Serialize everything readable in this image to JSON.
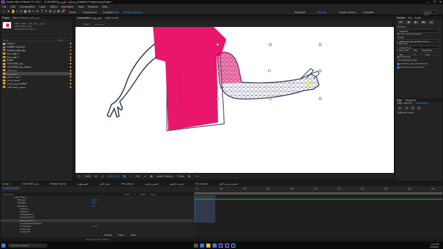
{
  "window": {
    "title": "Adobe After Effects CC 2017 - D:\\WORKS\\بروجيكت كورس\\Untitled Project copy2.aep *",
    "controls": [
      "—",
      "❐",
      "✕"
    ]
  },
  "menu": [
    "File",
    "Edit",
    "Composition",
    "Layer",
    "Effect",
    "Animation",
    "View",
    "Window",
    "Help"
  ],
  "toolbar": {
    "options": [
      "Mode",
      "Expansion",
      "3",
      "Triangles",
      "350",
      "Record Options"
    ],
    "workspaces": [
      "Standard",
      "Default",
      "Small Screen",
      "Libraries"
    ],
    "search_placeholder": "Search Help"
  },
  "project": {
    "tabs": [
      "Project",
      "Effect Controls جسم كامل"
    ],
    "meta_name": "قميص وجسم كامل - 1920 × 1080",
    "meta_line2": "1920 x 1080 (1.00)",
    "meta_line3": "Δ 0;00;20;00, 30.00 fps",
    "columns": [
      "Name",
      "Type"
    ],
    "items": [
      {
        "name": "Comp 1",
        "color": "#d9a23a"
      },
      {
        "name": "GAMED 400.mp4",
        "color": "#7a7a7a"
      },
      {
        "name": "Granted_logo.png",
        "color": "#7a7a7a"
      },
      {
        "name": "Pre-comp 1",
        "color": "#d9a23a"
      },
      {
        "name": "Pre-comp 2",
        "color": "#d9a23a"
      },
      {
        "name": "Solids",
        "color": "#d9a23a"
      },
      {
        "name": "YOUTUBE شعار",
        "color": "#d9a23a"
      },
      {
        "name": "YOUTUBE شعار Lalune",
        "color": "#d9a23a"
      },
      {
        "name": "جسم كامل",
        "color": "#d9a23a"
      },
      {
        "name": "جسم مع يد",
        "color": "#d9a23a",
        "selected": true
      },
      {
        "name": "جسم يد قميص",
        "color": "#d9a23a"
      },
      {
        "name": "قميص وجسم",
        "color": "#d9a23a"
      },
      {
        "name": "قميص وجسم Lalune",
        "color": "#d9a23a"
      },
      {
        "name": "قميص وجسم كامل",
        "color": "#d9a23a"
      }
    ],
    "bottom": [
      "8 bpc"
    ]
  },
  "viewer": {
    "tabs": [
      "Composition جسم مع يد",
      "Layer (none)"
    ],
    "subtabs": [
      "Comp 1",
      "جسم مع يد",
      "جسم كامل"
    ],
    "footer": {
      "zoom": "100%",
      "timecode": "0;00;00;00",
      "resolution": "Full",
      "camera": "Active Camera",
      "views": "1 View",
      "offset": "+0.0"
    }
  },
  "right": {
    "tabs": [
      "Preview",
      "Info",
      "Audio"
    ],
    "shortcut_label": "Shortcut",
    "shortcut_value": "Spacebar",
    "cache_label": "Cache Before Playback",
    "range_label": "Range",
    "range_value": "Work Area Extended By Current...",
    "play_from_label": "Play From",
    "play_from_value": "Current Time",
    "frame_rate_label": "Frame Rate",
    "skip_label": "Skip",
    "resolution_label": "Resolution",
    "frame_rate_value": "(30)",
    "skip_value": "0",
    "resolution_value": "Auto",
    "full_screen_label": "Full Screen",
    "stop_label": "On (Spacebar) Stop:",
    "opt1": "If caching, play cached frames",
    "opt2": "Move time to preview time",
    "align_tabs": [
      "Align",
      "Paragraph"
    ],
    "align_label": "Align Layers to:",
    "align_value": "Composition",
    "distribute_label": "Distribute Layers:"
  },
  "timeline": {
    "tabs": [
      "Comp 1",
      "YOUTUBE شعار",
      "Render Queue",
      "جسم مع يد",
      "جسم كامل",
      "Pre-comp 1",
      "قميص وجسم",
      "جسم يد قميص",
      "Pre-comp 2",
      "قميص وجسم كامل"
    ],
    "current_time": "0;00;00;00",
    "columns": [
      "Layer Name",
      "Mode",
      "T",
      "TrkMat",
      "Parent"
    ],
    "layers": [
      {
        "name": "Layer Name",
        "value": ""
      },
      {
        "name": "▾ Puppet",
        "value": "Reset"
      },
      {
        "name": "Triangles",
        "value": "350"
      },
      {
        "name": "Expansion",
        "value": "3.0"
      },
      {
        "name": "▾ Mesh 1",
        "value": ""
      },
      {
        "name": "▾ Deform",
        "value": ""
      },
      {
        "name": "▸ Puppet Pin 3",
        "value": ""
      },
      {
        "name": "▸ Puppet Pin 2",
        "value": ""
      },
      {
        "name": "▸ Puppet Pin 1",
        "value": "",
        "selected": true
      },
      {
        "name": "▸ Compositing Options",
        "value": ""
      },
      {
        "name": "▸ Transform",
        "value": "Reset"
      },
      {
        "name": "26  جسم مع",
        "value": ""
      },
      {
        "name": "▸ Layer 28",
        "value": ""
      }
    ],
    "layer_row_controls": [
      "Normal",
      "None",
      "None"
    ],
    "ruler": [
      "0f",
      "02s",
      "04s",
      "06s",
      "08s",
      "10s",
      "12s",
      "14s",
      "16s",
      "18s",
      "20s"
    ],
    "bottom": "Toggle Switches / Modes"
  },
  "taskbar": {
    "search_placeholder": "Type here to search",
    "time": "1:31 PM",
    "date": "1/15/2017"
  }
}
